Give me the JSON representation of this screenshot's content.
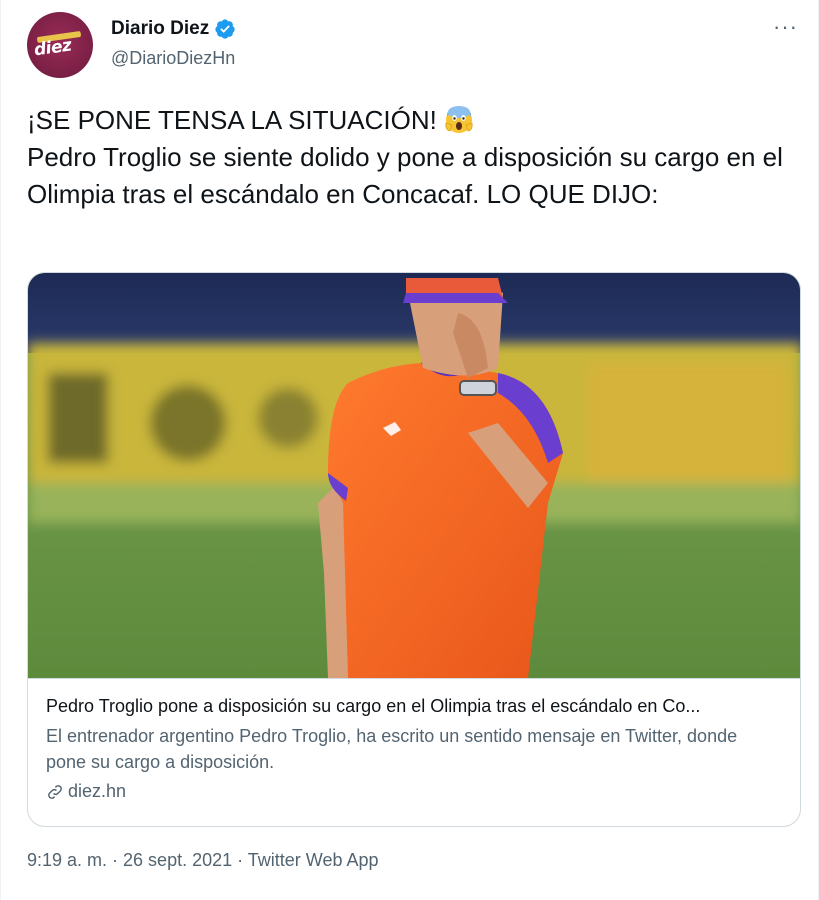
{
  "author": {
    "display_name": "Diario Diez",
    "handle": "@DiarioDiezHn",
    "avatar_text": "diez",
    "verified": true
  },
  "more_label": "···",
  "tweet": {
    "line1": "¡SE PONE TENSA LA SITUACIÓN!",
    "emoji": "face-screaming-in-fear",
    "line2": "Pedro Troglio se siente dolido y pone a disposición su cargo en el Olimpia tras el escándalo en Concacaf. LO QUE DIJO:"
  },
  "card": {
    "title": "Pedro Troglio pone a disposición su cargo en el Olimpia tras el escándalo en Co...",
    "description": "El entrenador argentino Pedro Troglio, ha escrito un sentido mensaje en Twitter, donde pone su cargo a disposición.",
    "domain": "diez.hn",
    "link_icon": "link-icon"
  },
  "footer": {
    "time": "9:19 a. m. · 26 sept. 2021 · Twitter Web App"
  },
  "colors": {
    "text": "#0f1419",
    "secondary": "#536471",
    "verified": "#1d9bf0",
    "border": "#cfd9de",
    "brand": "#7a1f45"
  }
}
